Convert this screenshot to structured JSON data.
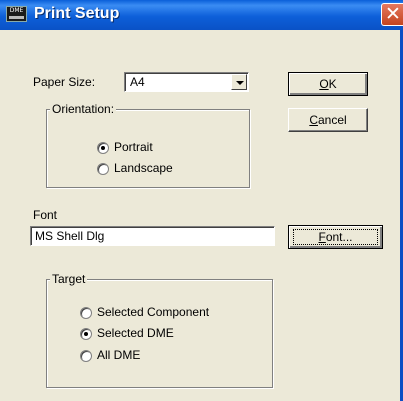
{
  "window": {
    "title": "Print Setup",
    "app_icon_text": "DME"
  },
  "paper": {
    "label": "Paper Size:",
    "value": "A4"
  },
  "buttons": {
    "ok": "OK",
    "cancel": "Cancel",
    "font": "Font..."
  },
  "orientation": {
    "legend": "Orientation:",
    "options": [
      {
        "label": "Portrait",
        "checked": true
      },
      {
        "label": "Landscape",
        "checked": false
      }
    ]
  },
  "font": {
    "label": "Font",
    "value": "MS Shell Dlg"
  },
  "target": {
    "legend": "Target",
    "options": [
      {
        "label": "Selected Component",
        "checked": false
      },
      {
        "label": "Selected DME",
        "checked": true
      },
      {
        "label": "All DME",
        "checked": false
      }
    ]
  }
}
